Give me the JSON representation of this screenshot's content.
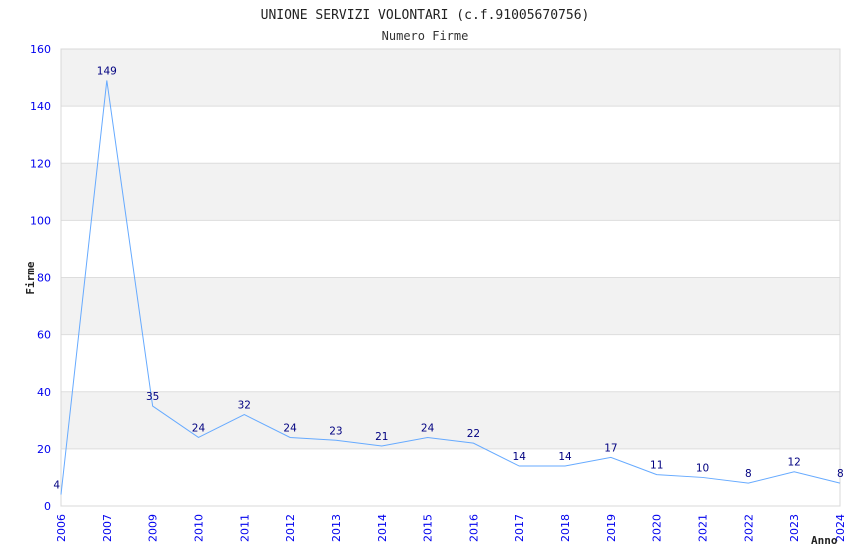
{
  "chart_data": {
    "type": "line",
    "title": "UNIONE SERVIZI VOLONTARI (c.f.91005670756)",
    "subtitle": "Numero Firme",
    "xlabel": "Anno",
    "ylabel": "Firme",
    "ylim": [
      0,
      160
    ],
    "yticks": [
      0,
      20,
      40,
      60,
      80,
      100,
      120,
      140,
      160
    ],
    "grid": true,
    "categories": [
      "2006",
      "2007",
      "2009",
      "2010",
      "2011",
      "2012",
      "2013",
      "2014",
      "2015",
      "2016",
      "2017",
      "2018",
      "2019",
      "2020",
      "2021",
      "2022",
      "2023",
      "2024"
    ],
    "values": [
      4,
      149,
      35,
      24,
      32,
      24,
      23,
      21,
      24,
      22,
      14,
      14,
      17,
      11,
      10,
      8,
      12,
      8
    ],
    "colors": {
      "line": "#66aaff",
      "band": "#f2f2f2",
      "tick": "#0000ee",
      "label": "#000080"
    }
  }
}
